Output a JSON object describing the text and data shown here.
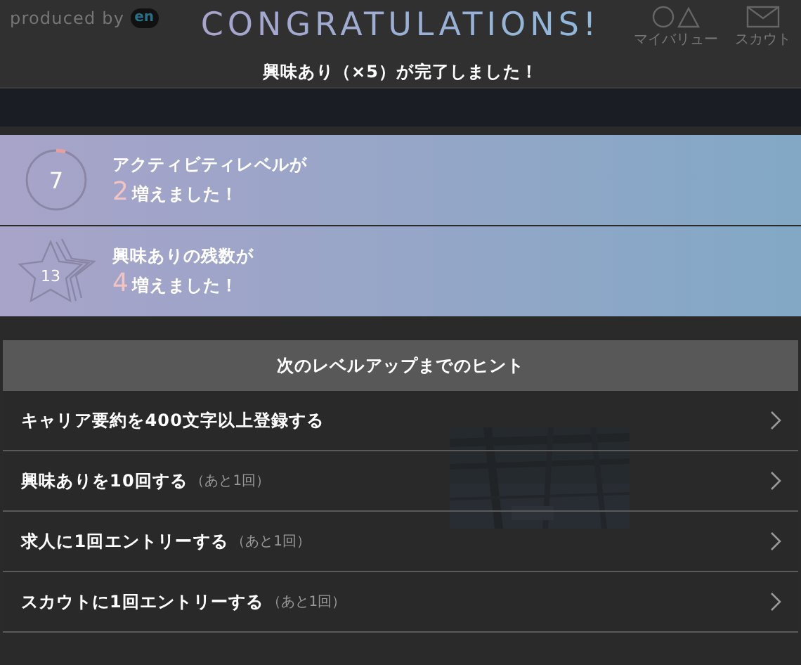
{
  "header": {
    "produced_by": "produced by",
    "logo": "en",
    "nav": [
      {
        "kind": "shapes",
        "label": "マイバリュー"
      },
      {
        "kind": "mail",
        "label": "スカウト"
      }
    ]
  },
  "modal": {
    "title": "CONGRATULATIONS!",
    "subtitle": "興味あり（×5）が完了しました！",
    "rewards": [
      {
        "kind": "ring",
        "badge": "7",
        "level": 0.05,
        "line1": "アクティビティレベルが",
        "amount": "2",
        "line2": "増えました！"
      },
      {
        "kind": "star",
        "badge": "13",
        "line1": "興味ありの残数が",
        "amount": "4",
        "line2": "増えました！"
      }
    ],
    "hints_title": "次のレベルアップまでのヒント",
    "hints": [
      {
        "text": "キャリア要約を400文字以上登録する"
      },
      {
        "text": "興味ありを10回する",
        "note": "（あと1回）"
      },
      {
        "text": "求人に1回エントリーする",
        "note": "（あと1回）"
      },
      {
        "text": "スカウトに1回エントリーする",
        "note": "（あと1回）"
      }
    ]
  }
}
